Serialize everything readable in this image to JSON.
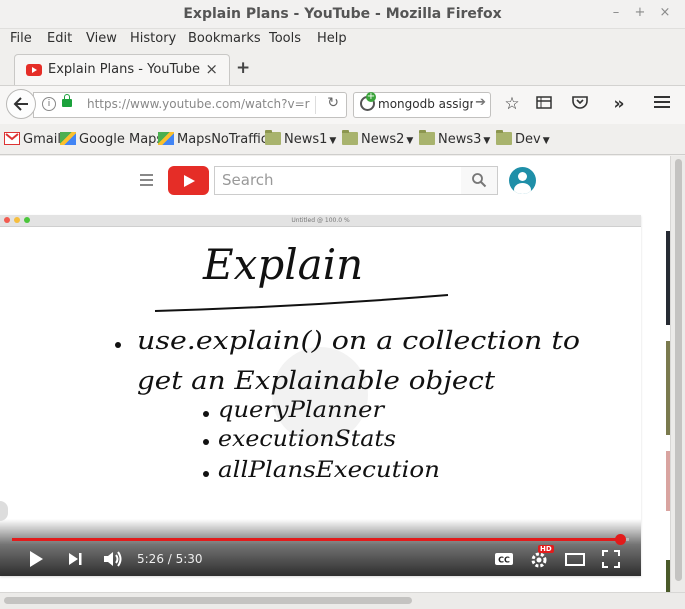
{
  "window": {
    "title": "Explain Plans - YouTube - Mozilla Firefox"
  },
  "menu": [
    "File",
    "Edit",
    "View",
    "History",
    "Bookmarks",
    "Tools",
    "Help"
  ],
  "tab": {
    "label": "Explain Plans - YouTube",
    "close": "×",
    "new_tab": "+"
  },
  "nav": {
    "url": "https://www.youtube.com/watch?v=r",
    "search_query": "mongodb assign"
  },
  "bookmarks": [
    {
      "label": "Gmail",
      "icon": "gmail-icon",
      "folder": false
    },
    {
      "label": "Google Maps",
      "icon": "maps-icon",
      "folder": false
    },
    {
      "label": "MapsNoTraffic",
      "icon": "maps-icon",
      "folder": false
    },
    {
      "label": "News1",
      "icon": "folder-icon",
      "folder": true
    },
    {
      "label": "News2",
      "icon": "folder-icon",
      "folder": true
    },
    {
      "label": "News3",
      "icon": "folder-icon",
      "folder": true
    },
    {
      "label": "Dev",
      "icon": "folder-icon",
      "folder": true
    }
  ],
  "youtube": {
    "search_placeholder": "Search",
    "accent": "#e52d27"
  },
  "video": {
    "window_title": "Untitled @ 100.0 %",
    "whiteboard": {
      "heading": "Explain",
      "bullets": [
        "use.explain() on a collection to",
        "get an Explainable object"
      ],
      "sub_bullets": [
        "queryPlanner",
        "executionStats",
        "allPlansExecution"
      ]
    },
    "time": "5:26 / 5:30",
    "progress": 0.985,
    "quality_badge": "HD"
  }
}
